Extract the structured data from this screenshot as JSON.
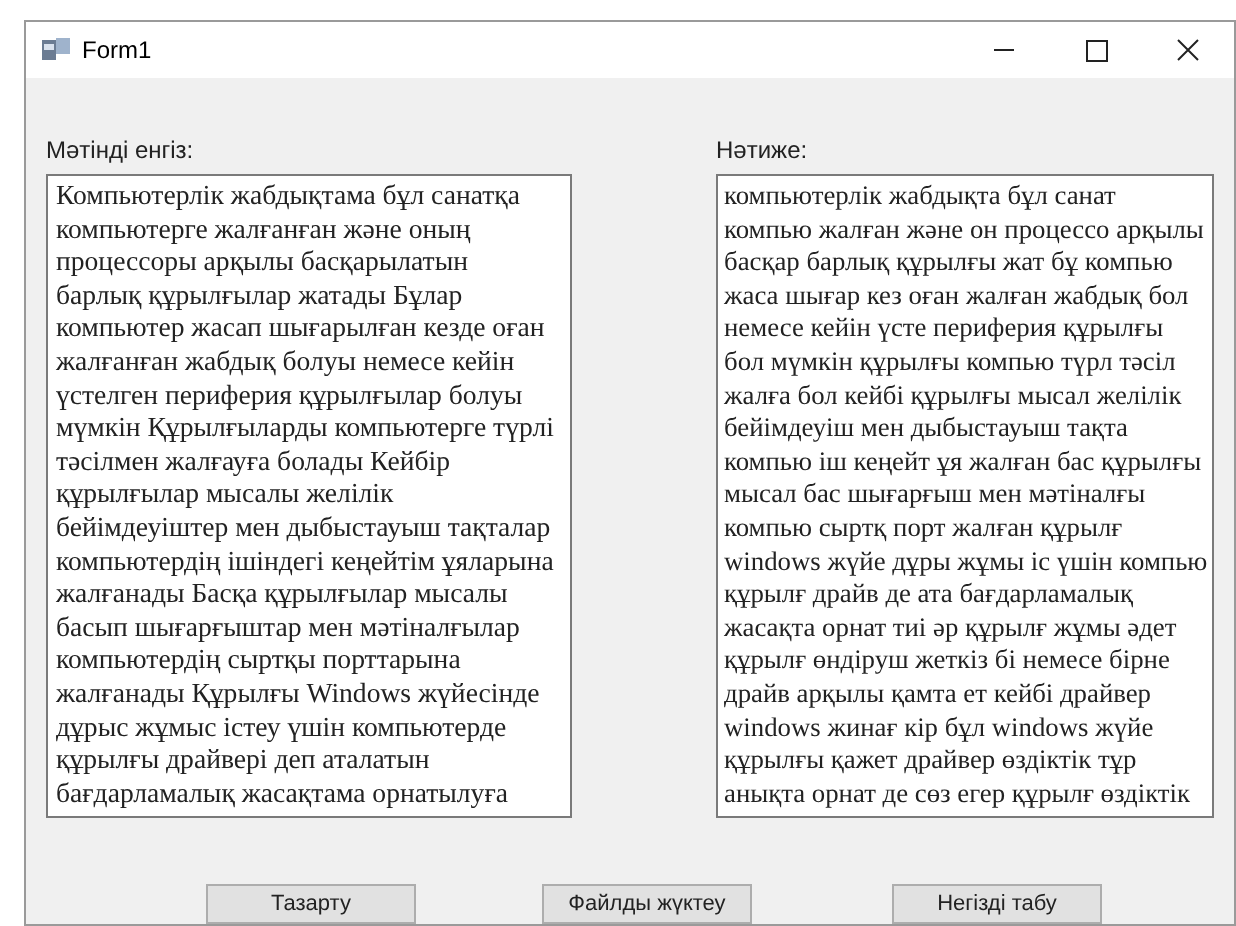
{
  "window": {
    "title": "Form1"
  },
  "input": {
    "label": "Мәтінді енгіз:",
    "text": "Компьютерлік жабдықтама бұл санатқа\nкомпьютерге жалғанған және оның\nпроцессоры арқылы басқарылатын\nбарлық құрылғылар жатады Бұлар\nкомпьютер жасап шығарылған кезде оған\nжалғанған жабдық болуы немесе кейін\nүстелген периферия құрылғылар болуы\nмүмкін Құрылғыларды компьютерге түрлі\nтәсілмен жалғауға болады Кейбір\nқұрылғылар мысалы желілік\nбейімдеуіштер мен дыбыстауыш тақталар\nкомпьютердің ішіндегі кеңейтім ұяларына\nжалғанады Басқа құрылғылар мысалы\nбасып шығарғыштар мен мәтіналғылар\nкомпьютердің сыртқы порттарына\nжалғанады Құрылғы Windows жүйесінде\nдұрыс жұмыс істеу үшін компьютерде\nқұрылғы драйвері деп аталатын\nбағдарламалық жасақтама орнатылуға"
  },
  "output": {
    "label": "Нәтиже:",
    "text": "компьютерлік жабдықта бұл санат\nкомпью жалған және он процессо арқылы\nбасқар барлық құрылғы жат бұ компью\nжаса шығар кез оған жалған жабдық бол\nнемесе кейін үсте периферия құрылғы\nбол мүмкін құрылғы компью түрл тәсіл\nжалға бол кейбі құрылғы мысал желілік\nбейімдеуіш мен дыбыстауыш тақта\nкомпью іш кеңейт ұя жалған бас құрылғы\nмысал бас шығарғыш мен мәтіналғы\nкомпью сыртқ порт жалған құрылғ\nwindows жүйе дұры жұмы іс үшін компью\nқұрылғ драйв де ата бағдарламалық\nжасақта орнат тиі әр құрылғ жұмы әдет\nқұрылғ өндіруш жеткіз бі немесе бірне\nдрайв арқылы қамта ет кейбі драйвер\nwindows жинағ кір бұл windows жүйе\nқұрылғы қажет драйвер өздіктік тұр\nанықта орнат де сөз егер құрылғ өздіктік"
  },
  "buttons": [
    "Тазарту",
    "Файлды жүктеу",
    "Негізді табу"
  ]
}
